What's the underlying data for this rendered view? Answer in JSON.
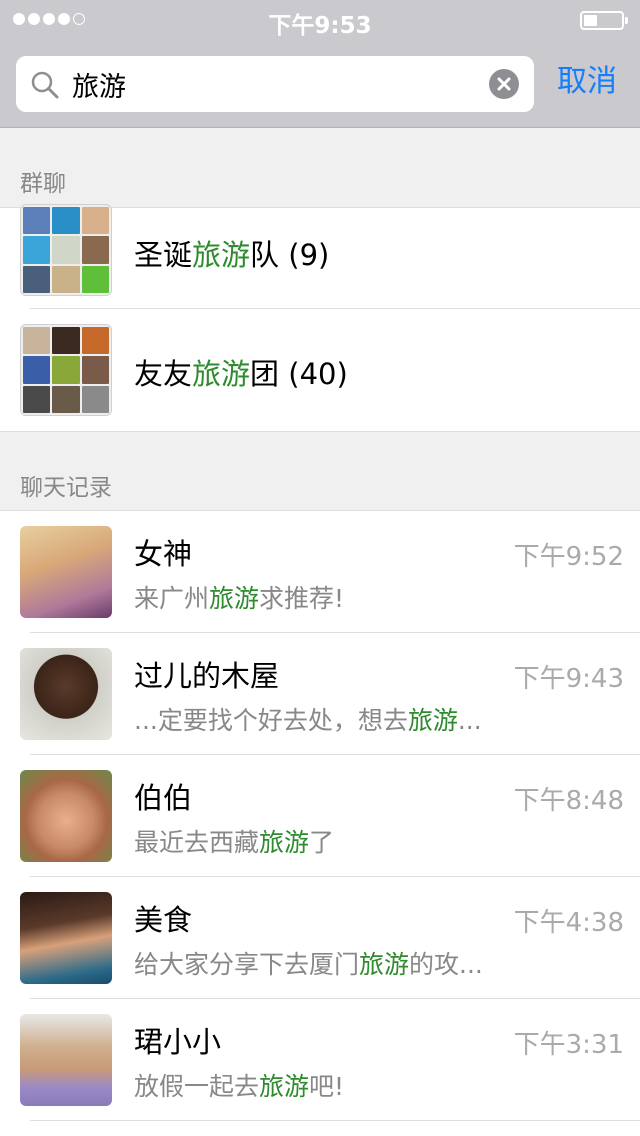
{
  "status_bar": {
    "time": "下午9:53"
  },
  "search": {
    "value": "旅游",
    "cancel_label": "取消"
  },
  "sections": {
    "groups_title": "群聊",
    "chats_title": "聊天记录"
  },
  "highlight": "旅游",
  "groups": [
    {
      "prefix": "圣诞",
      "suffix": "队 (9)"
    },
    {
      "prefix": "友友",
      "suffix": "团 (40)"
    }
  ],
  "chats": [
    {
      "name": "女神",
      "time": "下午9:52",
      "preview_before": "来广州",
      "preview_after": "求推荐!"
    },
    {
      "name": "过儿的木屋",
      "time": "下午9:43",
      "preview_before": "...定要找个好去处，想去",
      "preview_after": "..."
    },
    {
      "name": "伯伯",
      "time": "下午8:48",
      "preview_before": "最近去西藏",
      "preview_after": "了"
    },
    {
      "name": "美食",
      "time": "下午4:38",
      "preview_before": "给大家分享下去厦门",
      "preview_after": "的攻..."
    },
    {
      "name": "珺小小",
      "time": "下午3:31",
      "preview_before": "放假一起去",
      "preview_after": "吧!"
    }
  ],
  "colors": {
    "accent": "#157efb",
    "highlight": "#2e8b2e",
    "header_bg": "#c9c9ce"
  }
}
